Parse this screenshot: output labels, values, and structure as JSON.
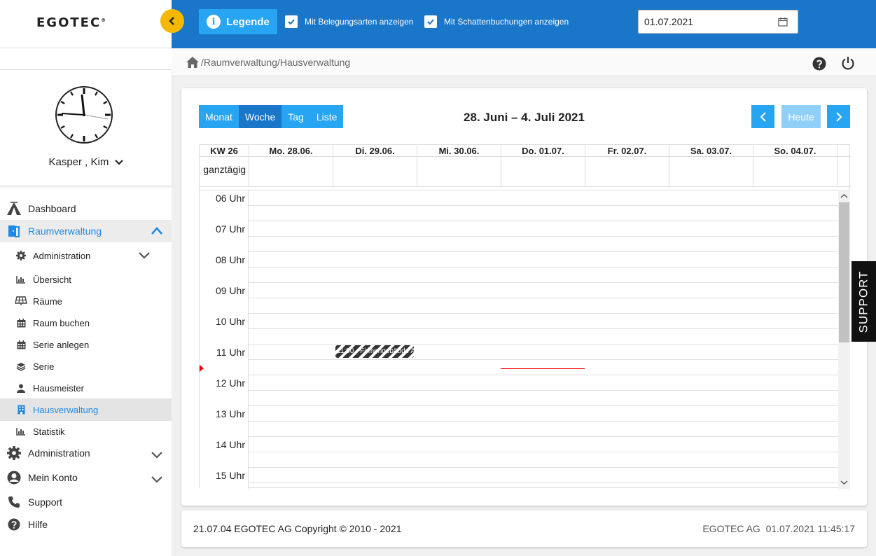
{
  "brand": {
    "logo": "EGOTEC",
    "mark": "®"
  },
  "toolbar": {
    "legend_label": "Legende",
    "info_glyph": "i",
    "cb_belegung": "Mit Belegungsarten anzeigen",
    "cb_schatten": "Mit Schattenbuchungen anzeigen",
    "date_value": "01.07.2021"
  },
  "breadcrumb": "/Raumverwaltung/Hausverwaltung",
  "user": {
    "name": "Kasper , Kim"
  },
  "nav": {
    "dashboard": "Dashboard",
    "raumverwaltung": "Raumverwaltung",
    "sub": {
      "administration": "Administration",
      "uebersicht": "Übersicht",
      "raeume": "Räume",
      "raum_buchen": "Raum buchen",
      "serie_anlegen": "Serie anlegen",
      "serie": "Serie",
      "hausmeister": "Hausmeister",
      "hausverwaltung": "Hausverwaltung",
      "statistik": "Statistik"
    },
    "administration": "Administration",
    "mein_konto": "Mein Konto",
    "support": "Support",
    "hilfe": "Hilfe"
  },
  "calendar": {
    "views": [
      "Monat",
      "Woche",
      "Tag",
      "Liste"
    ],
    "active_view": "Woche",
    "title": "28. Juni – 4. Juli 2021",
    "today_label": "Heute",
    "week_label": "KW 26",
    "allday_label": "ganztägig",
    "days": [
      "Mo. 28.06.",
      "Di. 29.06.",
      "Mi. 30.06.",
      "Do. 01.07.",
      "Fr. 02.07.",
      "Sa. 03.07.",
      "So. 04.07."
    ],
    "hours": [
      "06 Uhr",
      "07 Uhr",
      "08 Uhr",
      "09 Uhr",
      "10 Uhr",
      "11 Uhr",
      "12 Uhr",
      "13 Uhr",
      "14 Uhr",
      "15 Uhr"
    ],
    "event": {
      "text": "11:00 - Firmengebäude A",
      "day": "Di. 29.06."
    }
  },
  "footer": {
    "left": "21.07.04 EGOTEC AG Copyright © 2010 - 2021",
    "right": "EGOTEC AG  01.07.2021 11:45:17"
  },
  "support_tab": "SUPPORT",
  "colors": {
    "primary": "#1976c8",
    "accent": "#27a4f2",
    "warn": "#f5b800"
  }
}
